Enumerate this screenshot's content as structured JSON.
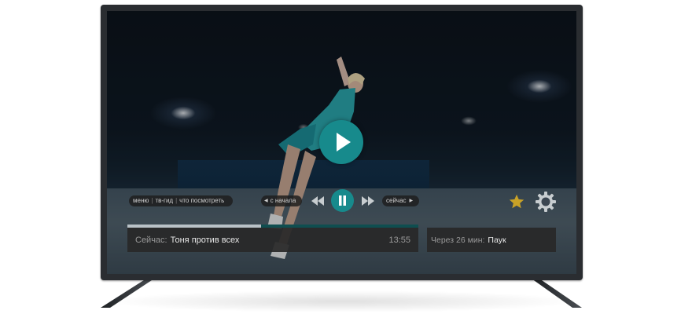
{
  "player": {
    "menu": {
      "items": [
        "меню",
        "тв-гид",
        "что посмотреть"
      ]
    },
    "controls": {
      "restart_label": "с начала",
      "live_label": "сейчас"
    },
    "progress": {
      "fraction": 0.46
    },
    "now_playing": {
      "prefix": "Сейчас:",
      "title": "Тоня против всех",
      "time": "13:55"
    },
    "up_next": {
      "prefix": "Через 26 мин:",
      "title": "Паук"
    },
    "icons": {
      "big_play": "play-icon",
      "rewind": "rewind-icon",
      "pause": "pause-icon",
      "forward": "fast-forward-icon",
      "favorite": "star-icon",
      "settings": "gear-icon"
    },
    "colors": {
      "accent": "#178a8c",
      "favorite": "#c9a227",
      "panel": "#282828",
      "frame": "#2a2d31"
    }
  }
}
